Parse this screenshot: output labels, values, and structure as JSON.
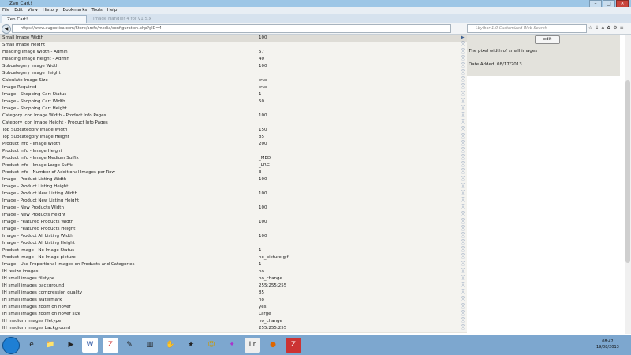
{
  "window": {
    "title": "Zen Cart!"
  },
  "menu": [
    "File",
    "Edit",
    "View",
    "History",
    "Bookmarks",
    "Tools",
    "Help"
  ],
  "tabs": [
    {
      "label": "Zen Cart!",
      "active": true
    },
    {
      "label": "Image Handler 4 for v1.5.x",
      "active": false
    }
  ],
  "address": {
    "url": "https://www.augustica.com/Store/arcfe/media/configuration.php?gID=4"
  },
  "search": {
    "placeholder": "Lbylbor 1.0 Customized Web Search"
  },
  "settings": [
    {
      "label": "Small Image Width",
      "value": "100"
    },
    {
      "label": "Small Image Height",
      "value": ""
    },
    {
      "label": "Heading Image Width - Admin",
      "value": "57"
    },
    {
      "label": "Heading Image Height - Admin",
      "value": "40"
    },
    {
      "label": "Subcategory Image Width",
      "value": "100"
    },
    {
      "label": "Subcategory Image Height",
      "value": ""
    },
    {
      "label": "Calculate Image Size",
      "value": "true"
    },
    {
      "label": "Image Required",
      "value": "true"
    },
    {
      "label": "Image - Shopping Cart Status",
      "value": "1"
    },
    {
      "label": "Image - Shopping Cart Width",
      "value": "50"
    },
    {
      "label": "Image - Shopping Cart Height",
      "value": ""
    },
    {
      "label": "Category Icon Image Width - Product Info Pages",
      "value": "100"
    },
    {
      "label": "Category Icon Image Height - Product Info Pages",
      "value": ""
    },
    {
      "label": "Top Subcategory Image Width",
      "value": "150"
    },
    {
      "label": "Top Subcategory Image Height",
      "value": "85"
    },
    {
      "label": "Product Info - Image Width",
      "value": "200"
    },
    {
      "label": "Product Info - Image Height",
      "value": ""
    },
    {
      "label": "Product Info - Image Medium Suffix",
      "value": "_MED"
    },
    {
      "label": "Product Info - Image Large Suffix",
      "value": "_LRG"
    },
    {
      "label": "Product Info - Number of Additional Images per Row",
      "value": "3"
    },
    {
      "label": "Image - Product Listing Width",
      "value": "100"
    },
    {
      "label": "Image - Product Listing Height",
      "value": ""
    },
    {
      "label": "Image - Product New Listing Width",
      "value": "100"
    },
    {
      "label": "Image - Product New Listing Height",
      "value": ""
    },
    {
      "label": "Image - New Products Width",
      "value": "100"
    },
    {
      "label": "Image - New Products Height",
      "value": ""
    },
    {
      "label": "Image - Featured Products Width",
      "value": "100"
    },
    {
      "label": "Image - Featured Products Height",
      "value": ""
    },
    {
      "label": "Image - Product All Listing Width",
      "value": "100"
    },
    {
      "label": "Image - Product All Listing Height",
      "value": ""
    },
    {
      "label": "Product Image - No Image Status",
      "value": "1"
    },
    {
      "label": "Product Image - No Image picture",
      "value": "no_picture.gif"
    },
    {
      "label": "Image - Use Proportional Images on Products and Categories",
      "value": "1"
    },
    {
      "label": "IH resize images",
      "value": "no"
    },
    {
      "label": "IH small images filetype",
      "value": "no_change"
    },
    {
      "label": "IH small images background",
      "value": "255:255:255"
    },
    {
      "label": "IH small images compression quality",
      "value": "85"
    },
    {
      "label": "IH small images watermark",
      "value": "no"
    },
    {
      "label": "IH small images zoom on hover",
      "value": "yes"
    },
    {
      "label": "IH small images zoom on hover size",
      "value": "Large"
    },
    {
      "label": "IH medium images filetype",
      "value": "no_change"
    },
    {
      "label": "IH medium images background",
      "value": "255:255:255"
    }
  ],
  "detail": {
    "edit_label": "edit",
    "description": "The pixel width of small images",
    "date_added": "Date Added: 08/17/2013"
  },
  "taskbar": {
    "time": "08:42",
    "date": "19/08/2013"
  },
  "colors": {
    "row_bg": "#f4f3ef",
    "row_selected": "#dedcd6",
    "info_icon": "#3d5f91",
    "taskbar": "#7da7cf"
  }
}
